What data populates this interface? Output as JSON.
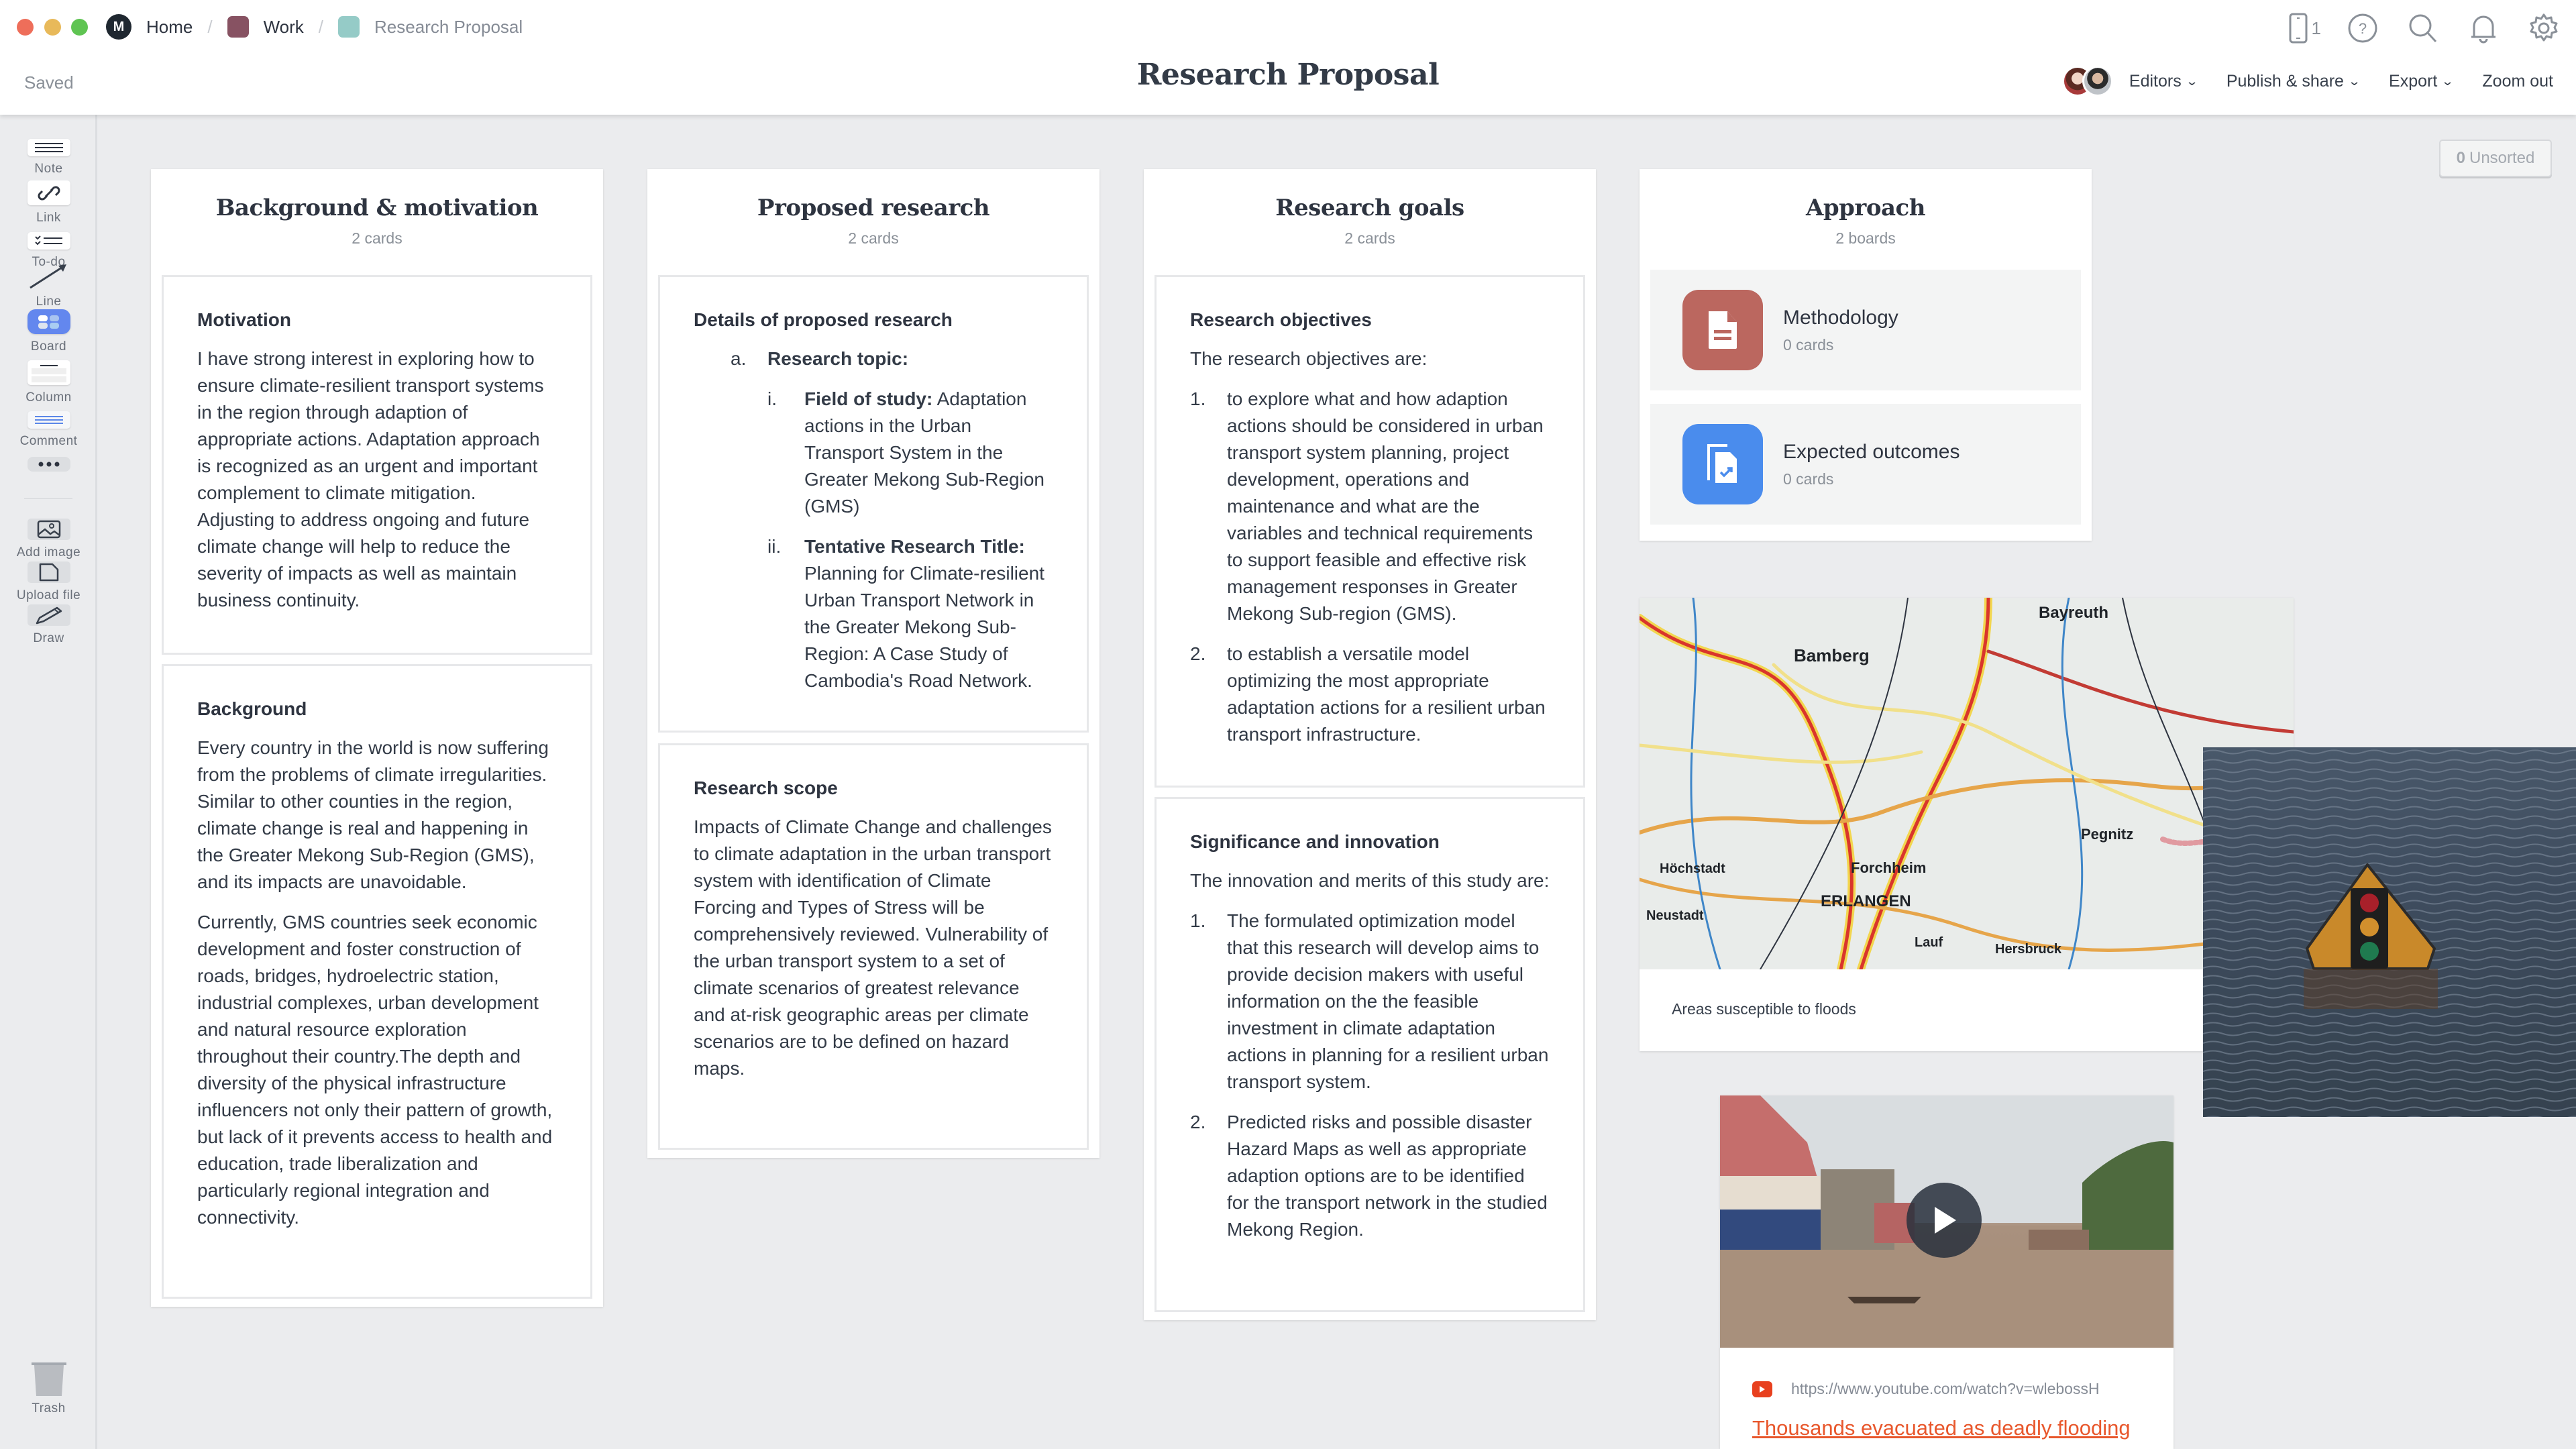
{
  "window": {
    "breadcrumbs": [
      {
        "label": "Home",
        "color": "#1f2730"
      },
      {
        "label": "Work",
        "color": "#875262"
      },
      {
        "label": "Research Proposal",
        "color": "#95cbc7"
      }
    ],
    "saved_status": "Saved",
    "title": "Research Proposal",
    "device_count": "1"
  },
  "header_actions": {
    "editors": "Editors",
    "publish": "Publish & share",
    "export": "Export",
    "zoom_out": "Zoom out"
  },
  "sidebar": {
    "tools": [
      {
        "label": "Note",
        "icon": "note-icon"
      },
      {
        "label": "Link",
        "icon": "link-icon"
      },
      {
        "label": "To-do",
        "icon": "todo-icon"
      },
      {
        "label": "Line",
        "icon": "line-arrow-icon"
      },
      {
        "label": "Board",
        "icon": "board-icon"
      },
      {
        "label": "Column",
        "icon": "column-icon"
      },
      {
        "label": "Comment",
        "icon": "comment-icon"
      },
      {
        "label": "",
        "icon": "more-icon"
      },
      {
        "label": "Add image",
        "icon": "image-icon"
      },
      {
        "label": "Upload file",
        "icon": "file-icon"
      },
      {
        "label": "Draw",
        "icon": "pencil-icon"
      }
    ],
    "trash": "Trash"
  },
  "unsorted": {
    "count": "0",
    "label": "Unsorted"
  },
  "columns": [
    {
      "title": "Background & motivation",
      "subtitle": "2 cards",
      "cards": [
        {
          "title": "Motivation",
          "paragraphs": [
            "I have strong interest in exploring how to ensure climate-resilient transport systems in the region through adaption of appropriate actions. Adaptation approach is recognized as an urgent and important complement to climate mitigation. Adjusting to address ongoing and future climate change will help to reduce the severity of impacts as well as maintain business continuity."
          ]
        },
        {
          "title": "Background",
          "paragraphs": [
            "Every country in the world is now suffering from the problems of climate irregularities. Similar to other counties in the region, climate change is real and happening in the Greater Mekong Sub-Region (GMS), and its impacts are unavoidable.",
            "Currently, GMS countries seek economic development and foster construction of roads, bridges, hydroelectric station, industrial complexes, urban development and natural resource exploration throughout their country.The depth and diversity of the physical infrastructure influencers not only their pattern of growth, but lack of it prevents access to health and education, trade liberalization and particularly regional integration and connectivity."
          ]
        }
      ]
    },
    {
      "title": "Proposed research",
      "subtitle": "2 cards",
      "cards": [
        {
          "title": "Details of proposed research",
          "list_a_marker": "a.",
          "list_a_label": "Research topic:",
          "items": [
            {
              "marker": "i.",
              "label": "Field of study:",
              "text": " Adaptation actions in the Urban Transport System in the Greater Mekong Sub-Region (GMS)"
            },
            {
              "marker": "ii.",
              "label": "Tentative Research Title:",
              "text": "Planning for Climate-resilient Urban Transport Network in the Greater Mekong Sub-Region: A Case Study of Cambodia's Road Network."
            }
          ]
        },
        {
          "title": "Research scope",
          "paragraphs": [
            "Impacts of Climate Change and challenges to climate adaptation in the urban transport system with identification of Climate Forcing and Types of Stress will be comprehensively reviewed. Vulnerability of the urban transport system to a set of climate scenarios of greatest relevance and at-risk geographic areas per climate scenarios are to be defined on hazard maps."
          ]
        }
      ]
    },
    {
      "title": "Research goals",
      "subtitle": "2 cards",
      "cards": [
        {
          "title": "Research objectives",
          "intro": "The research objectives are:",
          "items": [
            {
              "marker": "1.",
              "text": "to explore what and how adaption actions should be considered in urban transport system planning, project development, operations and maintenance and what are the variables and technical requirements to support feasible and effective risk management responses in Greater Mekong Sub-region (GMS)."
            },
            {
              "marker": "2.",
              "text": "to establish a versatile model optimizing the most appropriate adaptation actions for a resilient urban transport infrastructure."
            }
          ]
        },
        {
          "title": "Significance and innovation",
          "intro": "The innovation and merits of this study are:",
          "items": [
            {
              "marker": "1.",
              "text": "The formulated optimization model that this research will develop aims to provide decision makers with useful information on the the feasible investment in climate adaptation actions in planning for a resilient urban transport system."
            },
            {
              "marker": "2.",
              "text": "Predicted risks and possible disaster Hazard Maps as well as appropriate adaption options are to be identified for the transport network in the studied Mekong Region."
            }
          ]
        }
      ]
    },
    {
      "title": "Approach",
      "subtitle": "2 boards",
      "boards": [
        {
          "name": "Methodology",
          "count": "0 cards",
          "color": "#bb675f",
          "icon": "document-icon"
        },
        {
          "name": "Expected outcomes",
          "count": "0 cards",
          "color": "#4a8ced",
          "icon": "outcomes-icon"
        }
      ]
    }
  ],
  "map_card": {
    "caption": "Areas susceptible to floods",
    "labels": [
      "Bamberg",
      "Bayreuth",
      "Forchheim",
      "ERLANGEN",
      "Pegnitz",
      "Höchstadt",
      "Neustadt",
      "Lauf",
      "Hersbruck"
    ]
  },
  "video_card": {
    "url": "https://www.youtube.com/watch?v=wlebossH",
    "title": "Thousands evacuated as deadly flooding"
  }
}
